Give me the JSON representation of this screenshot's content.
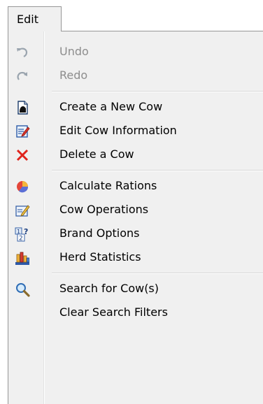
{
  "menubar": {
    "title": "Edit"
  },
  "menu": {
    "groups": [
      {
        "items": [
          {
            "label": "Undo",
            "icon": "undo-icon",
            "enabled": false
          },
          {
            "label": "Redo",
            "icon": "redo-icon",
            "enabled": false
          }
        ]
      },
      {
        "items": [
          {
            "label": "Create a New Cow",
            "icon": "new-document-icon",
            "enabled": true
          },
          {
            "label": "Edit Cow Information",
            "icon": "edit-document-icon",
            "enabled": true
          },
          {
            "label": "Delete a Cow",
            "icon": "delete-x-icon",
            "enabled": true
          }
        ]
      },
      {
        "items": [
          {
            "label": "Calculate Rations",
            "icon": "pie-chart-icon",
            "enabled": true
          },
          {
            "label": "Cow Operations",
            "icon": "pencil-note-icon",
            "enabled": true
          },
          {
            "label": "Brand Options",
            "icon": "brand-numbers-icon",
            "enabled": true
          },
          {
            "label": "Herd Statistics",
            "icon": "bar-chart-icon",
            "enabled": true
          }
        ]
      },
      {
        "items": [
          {
            "label": "Search for Cow(s)",
            "icon": "magnifier-icon",
            "enabled": true
          },
          {
            "label": "Clear Search Filters",
            "icon": "",
            "enabled": true
          }
        ]
      }
    ]
  },
  "colors": {
    "menu_background": "#f0f0f0",
    "disabled_text": "#8d8d8d",
    "delete_red": "#e0231c"
  }
}
